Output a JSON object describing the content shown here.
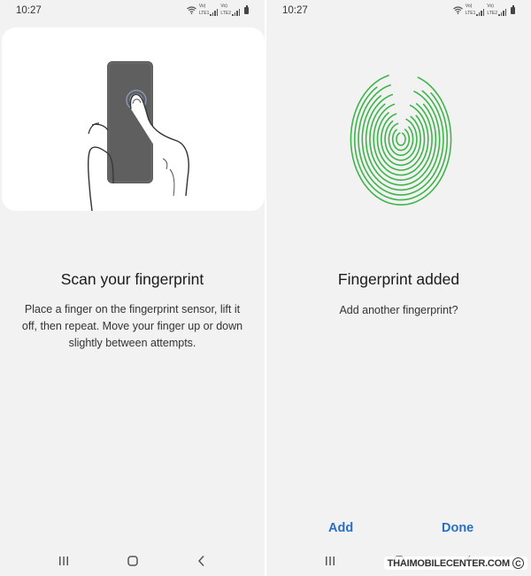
{
  "left_screen": {
    "status": {
      "time": "10:27",
      "sim1_top": "Vo)",
      "sim1_label": "LTE1",
      "sim2_top": "Vo)",
      "sim2_label": "LTE2",
      "icons": [
        "wifi-icon",
        "signal-icon",
        "battery-icon"
      ]
    },
    "title": "Scan your fingerprint",
    "description": "Place a finger on the fingerprint sensor, lift it off, then repeat. Move your finger up or down slightly between attempts.",
    "nav": [
      "recent-apps-icon",
      "home-icon",
      "back-icon"
    ]
  },
  "right_screen": {
    "status": {
      "time": "10:27",
      "sim1_top": "Vo)",
      "sim1_label": "LTE1",
      "sim2_top": "Vo)",
      "sim2_label": "LTE2",
      "icons": [
        "wifi-icon",
        "signal-icon",
        "battery-icon"
      ]
    },
    "title": "Fingerprint added",
    "question": "Add another fingerprint?",
    "add_label": "Add",
    "done_label": "Done",
    "nav": [
      "recent-apps-icon",
      "home-icon",
      "back-icon"
    ]
  },
  "watermark": {
    "text": "THAIMOBILECENTER.COM",
    "symbol": "C"
  },
  "colors": {
    "screen_bg": "#f2f2f2",
    "accent": "#2a6fc2",
    "fingerprint": "#3db54a"
  }
}
